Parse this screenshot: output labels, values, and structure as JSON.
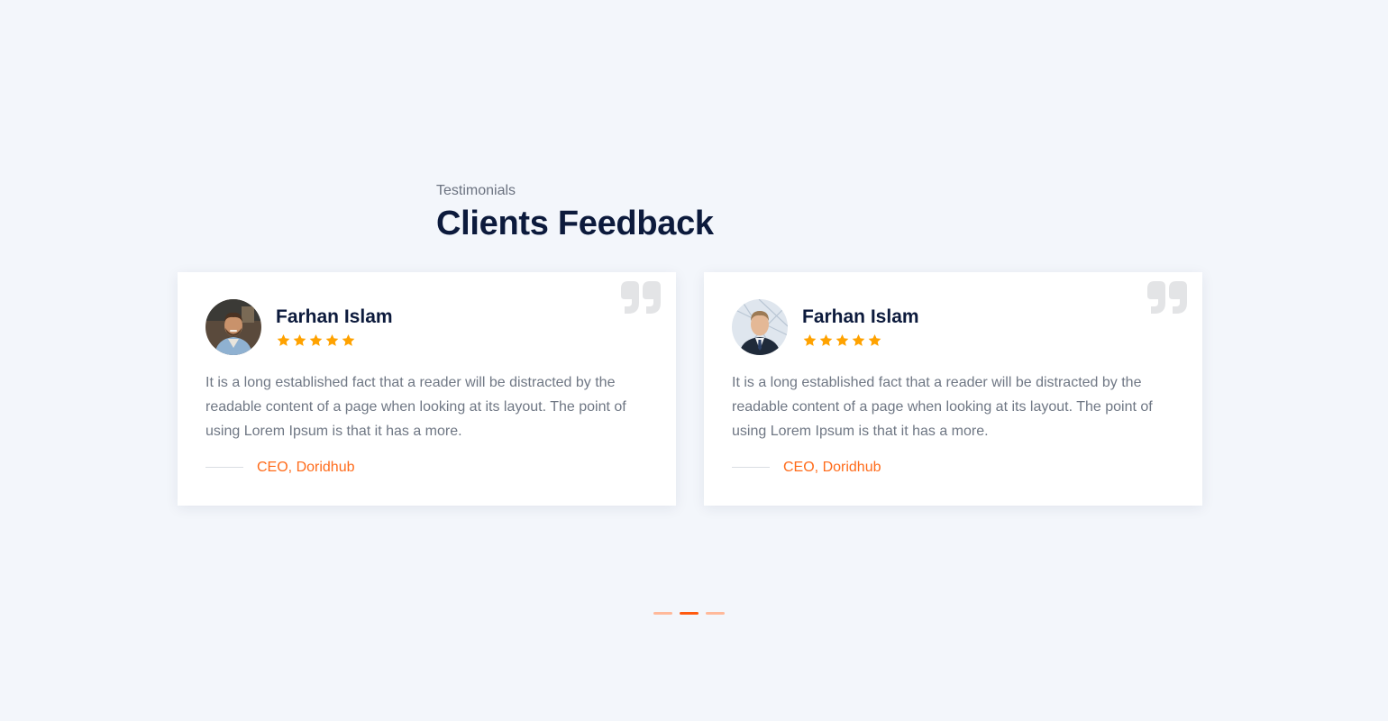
{
  "section": {
    "subtitle": "Testimonials",
    "title": "Clients Feedback"
  },
  "testimonials": [
    {
      "name": "Farhan Islam",
      "rating": 5,
      "text": "It is a long established fact that a reader will be distracted by the readable content of a page when looking at its layout. The point of using Lorem Ipsum is that it has a more.",
      "role": "CEO, Doridhub",
      "avatar_icon": "person-avatar-casual-icon"
    },
    {
      "name": "Farhan Islam",
      "rating": 5,
      "text": "It is a long established fact that a reader will be distracted by the readable content of a page when looking at its layout. The point of using Lorem Ipsum is that it has a more.",
      "role": "CEO, Doridhub",
      "avatar_icon": "person-avatar-suit-icon"
    }
  ],
  "carousel": {
    "page_count": 3,
    "active_index": 1
  },
  "colors": {
    "background": "#f3f6fb",
    "title": "#0c1a3c",
    "accent": "#ff5a0f",
    "accent_light": "#ffb99a",
    "star": "#ffa200",
    "quote_icon": "#e3e4e6"
  }
}
